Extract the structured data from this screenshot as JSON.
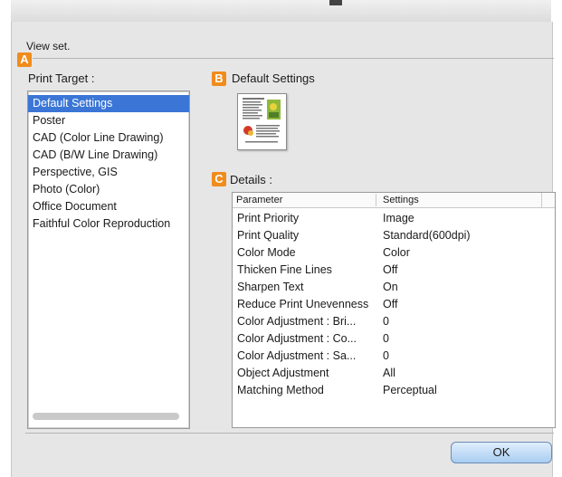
{
  "dialog": {
    "view_set_label": "View set.",
    "print_target_label": "Print Target :",
    "print_targets": [
      "Default Settings",
      "Poster",
      "CAD (Color Line Drawing)",
      "CAD (B/W Line Drawing)",
      "Perspective, GIS",
      "Photo (Color)",
      "Office Document",
      "Faithful Color Reproduction"
    ],
    "selected_target": "Default Settings",
    "preview_label": "Default Settings",
    "details_label": "Details :",
    "badges": {
      "a": "A",
      "b": "B",
      "c": "C"
    },
    "table_headers": {
      "parameter": "Parameter",
      "settings": "Settings"
    },
    "details_rows": [
      {
        "parameter": "Print Priority",
        "setting": "Image"
      },
      {
        "parameter": "Print Quality",
        "setting": "Standard(600dpi)"
      },
      {
        "parameter": "Color Mode",
        "setting": "Color"
      },
      {
        "parameter": "Thicken Fine Lines",
        "setting": "Off"
      },
      {
        "parameter": "Sharpen Text",
        "setting": "On"
      },
      {
        "parameter": "Reduce Print Unevenness",
        "setting": "Off"
      },
      {
        "parameter": "Color Adjustment : Bri...",
        "setting": "0"
      },
      {
        "parameter": "Color Adjustment : Co...",
        "setting": "0"
      },
      {
        "parameter": "Color Adjustment : Sa...",
        "setting": "0"
      },
      {
        "parameter": "Object Adjustment",
        "setting": "All"
      },
      {
        "parameter": "Matching Method",
        "setting": "Perceptual"
      }
    ],
    "ok_label": "OK"
  },
  "colors": {
    "badge": "#f08c1c",
    "selection": "#3b76d6",
    "ok_button": "#a9cdf2"
  }
}
